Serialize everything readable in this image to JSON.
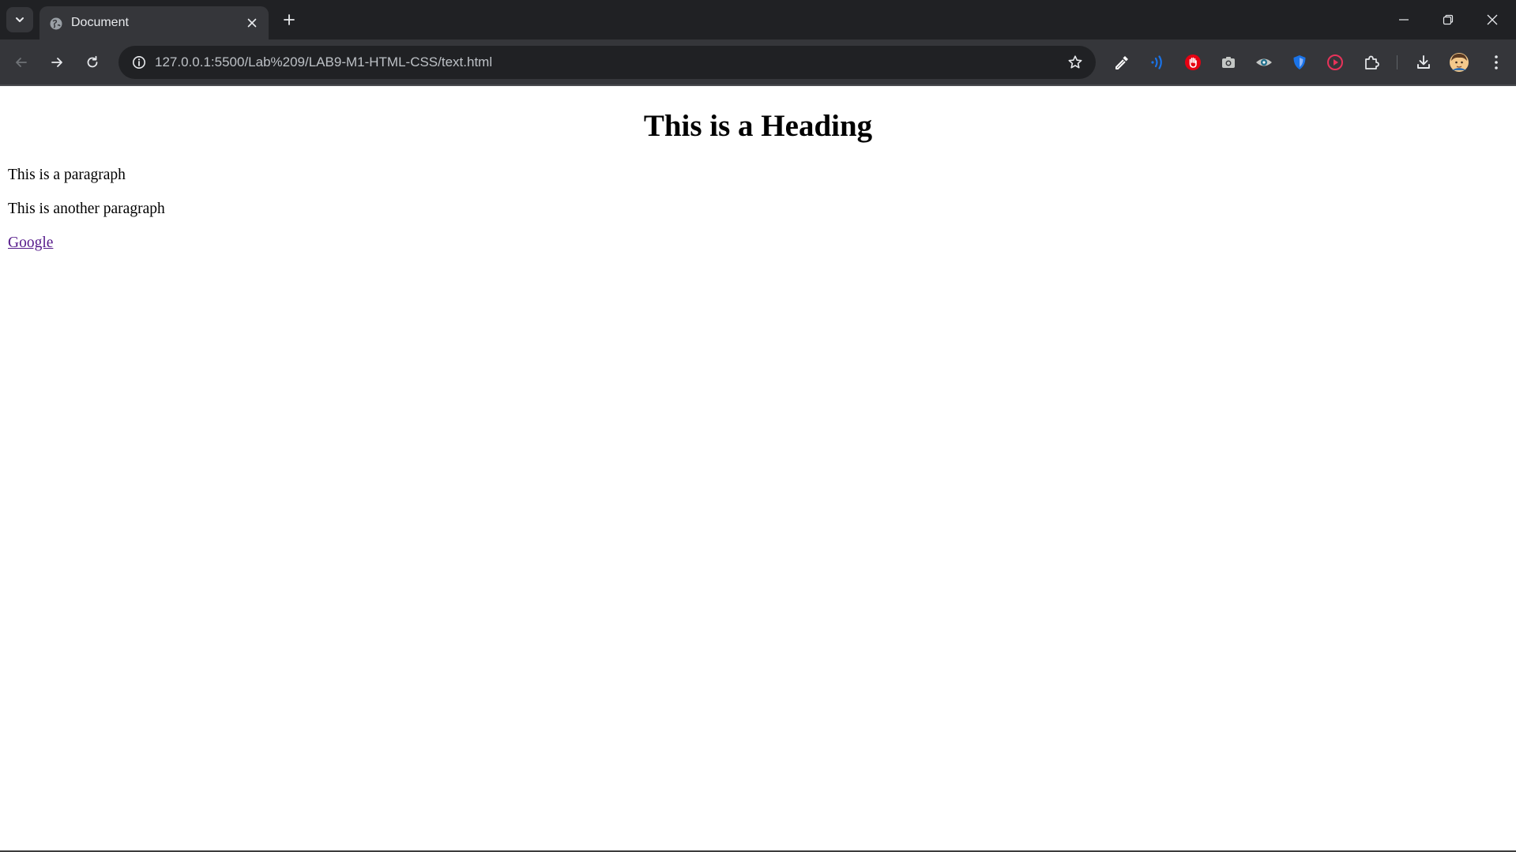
{
  "window": {
    "tab_title": "Document",
    "buttons": {
      "tab_search": "chevron-down-icon",
      "new_tab": "plus-icon",
      "minimize": "minimize-icon",
      "restore": "restore-icon",
      "close": "close-icon"
    }
  },
  "toolbar": {
    "url": "127.0.0.1:5500/Lab%209/LAB9-M1-HTML-CSS/text.html",
    "back_enabled": false,
    "forward_enabled": true,
    "extensions": [
      "eyedropper-icon",
      "wave-icon",
      "hand-stop-icon",
      "camera-icon",
      "eye-icon",
      "shield-icon",
      "play-record-icon",
      "puzzle-icon"
    ],
    "colors": {
      "tabstrip": "#202124",
      "toolbar": "#35363a",
      "omnibox": "#202124",
      "text": "#e8eaed"
    }
  },
  "page": {
    "heading": "This is a Heading",
    "paragraph_1": "This is a paragraph",
    "paragraph_2": "This is another paragraph",
    "link_text": "Google",
    "link_color": "#551a8b"
  }
}
